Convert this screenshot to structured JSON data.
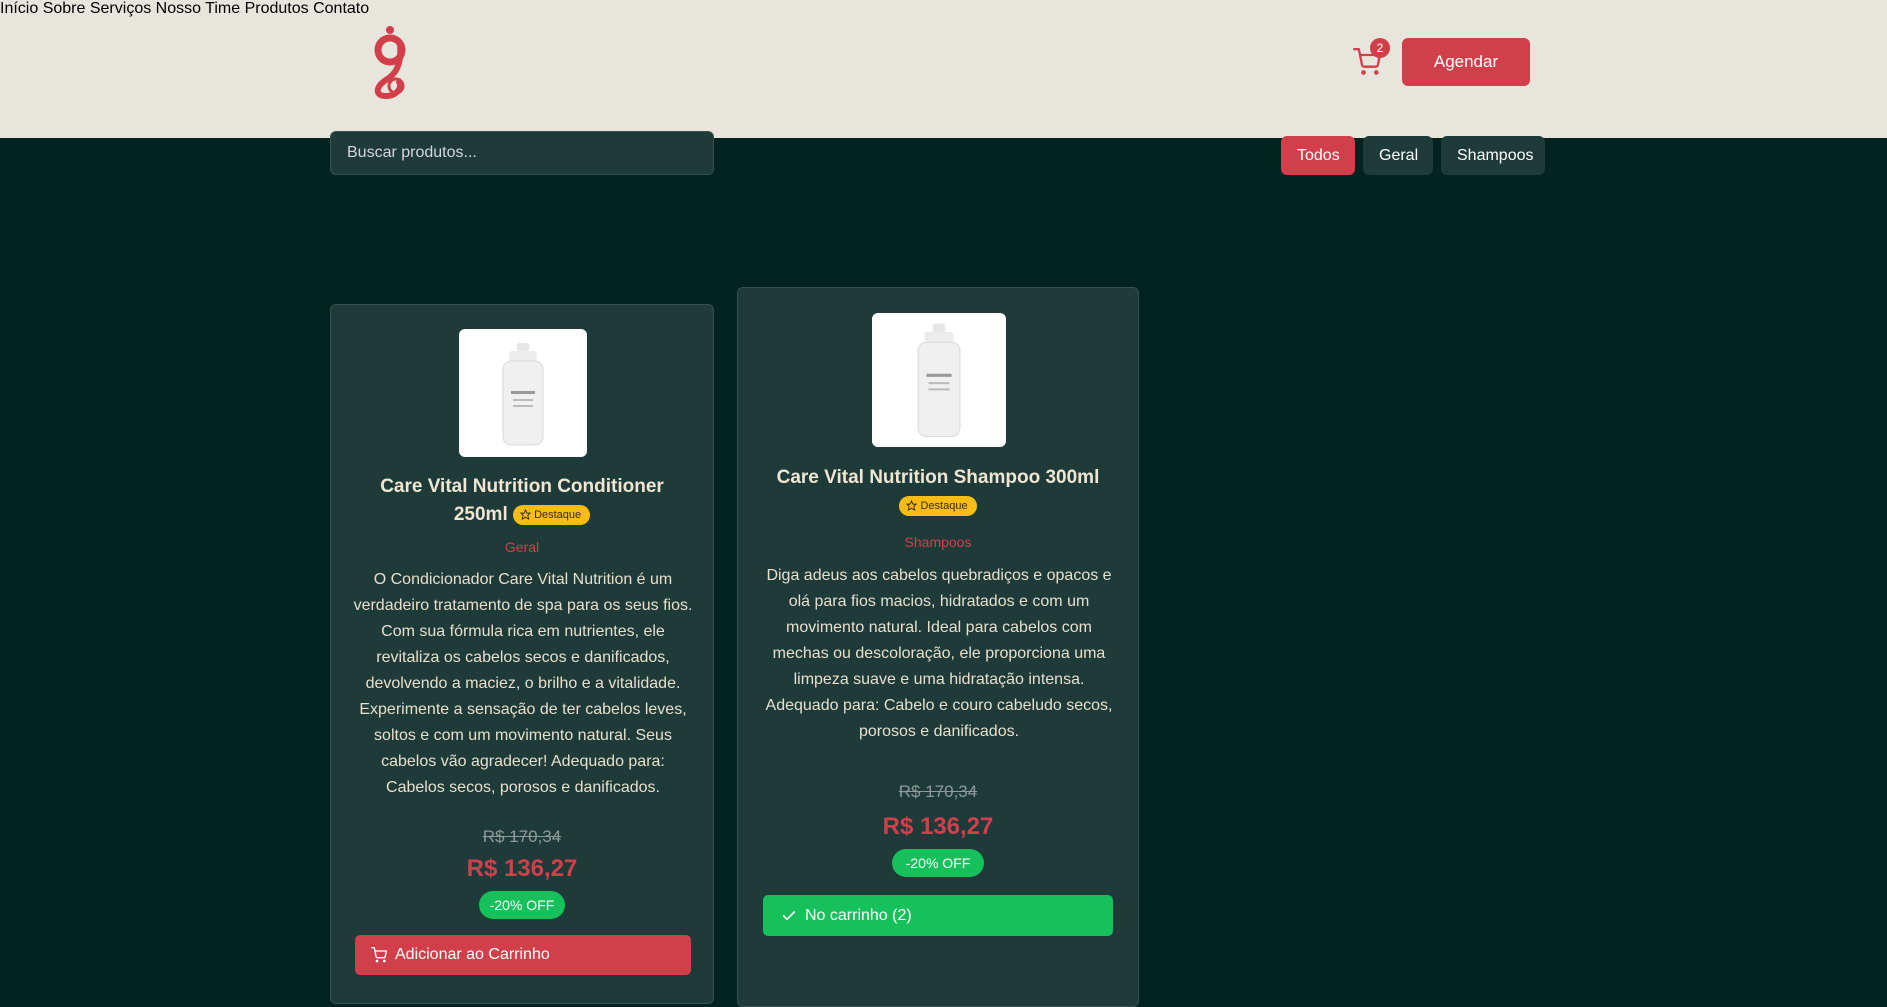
{
  "header": {
    "nav": [
      "Início",
      "Sobre",
      "Serviços",
      "Nosso Time",
      "Produtos",
      "Contato"
    ],
    "cart_count": "2",
    "cta_label": "Agendar",
    "brand_color": "#d1404a"
  },
  "search": {
    "placeholder": "Buscar produtos..."
  },
  "filters": [
    "Todos",
    "Geral",
    "Shampoos"
  ],
  "products": [
    {
      "title": "Care Vital Nutrition Conditioner 250ml",
      "badge": "Destaque",
      "category": "Geral",
      "description": "O Condicionador Care Vital Nutrition é um verdadeiro tratamento de spa para os seus fios. Com sua fórmula rica em nutrientes, ele revitaliza os cabelos secos e danificados, devolvendo a maciez, o brilho e a vitalidade. Experimente a sensação de ter cabelos leves, soltos e com um movimento natural. Seus cabelos vão agradecer! Adequado para: Cabelos secos, porosos e danificados.",
      "old_price": "R$ 170,34",
      "price": "R$ 136,27",
      "discount": "-20% OFF",
      "button": "Adicionar ao Carrinho"
    },
    {
      "title": "Care Vital Nutrition Shampoo 300ml",
      "badge": "Destaque",
      "category": "Shampoos",
      "description": "Diga adeus aos cabelos quebradiços e opacos e olá para fios macios, hidratados e com um movimento natural. Ideal para cabelos com mechas ou descoloração, ele proporciona uma limpeza suave e uma hidratação intensa. Adequado para: Cabelo e couro cabeludo secos, porosos e danificados.",
      "old_price": "R$ 170,34",
      "price": "R$ 136,27",
      "discount": "-20% OFF",
      "button": "No carrinho (2)"
    }
  ]
}
